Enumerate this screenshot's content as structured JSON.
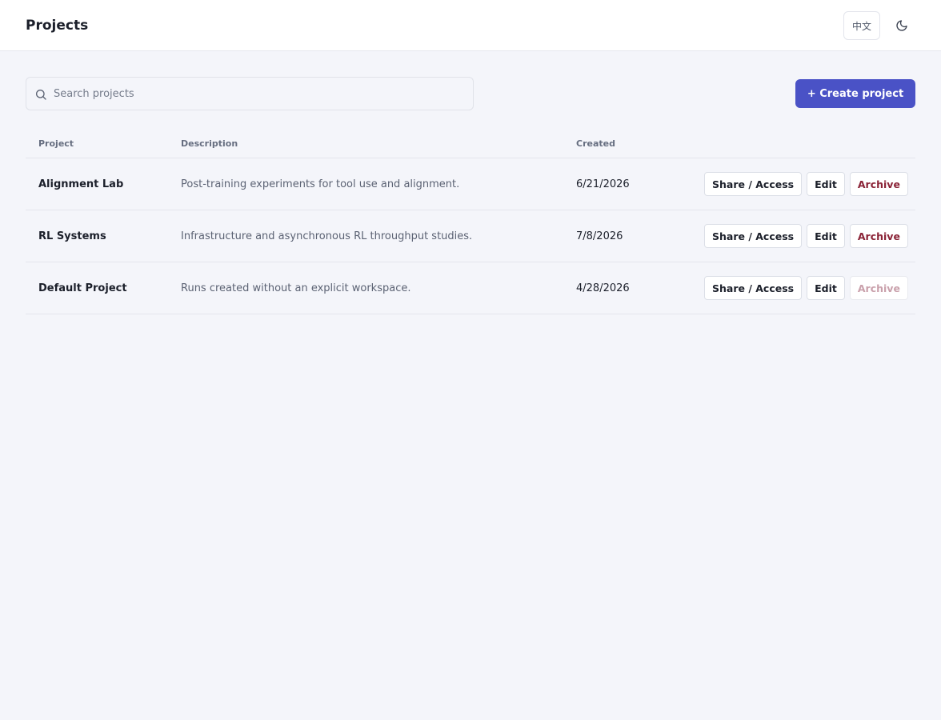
{
  "header": {
    "title": "Projects",
    "language_label": "中文",
    "theme_icon": "moon-icon"
  },
  "toolbar": {
    "search_placeholder": "Search projects",
    "search_value": "",
    "create_label": "+ Create project",
    "create_color": "#4a52c6"
  },
  "table": {
    "columns": {
      "project": "Project",
      "description": "Description",
      "created": "Created"
    },
    "rows": [
      {
        "name": "Alignment Lab",
        "description": "Post-training experiments for tool use and alignment.",
        "created": "6/21/2026",
        "share": "Share / Access",
        "edit": "Edit",
        "archive": "Archive",
        "archive_enabled": true
      },
      {
        "name": "RL Systems",
        "description": "Infrastructure and asynchronous RL throughput studies.",
        "created": "7/8/2026",
        "share": "Share / Access",
        "edit": "Edit",
        "archive": "Archive",
        "archive_enabled": true
      },
      {
        "name": "Default Project",
        "description": "Runs created without an explicit workspace.",
        "created": "4/28/2026",
        "share": "Share / Access",
        "edit": "Edit",
        "archive": "Archive",
        "archive_enabled": false
      }
    ]
  },
  "colors": {
    "accent": "#4a52c6",
    "danger": "#8a2236",
    "background": "#f4f5fa"
  }
}
